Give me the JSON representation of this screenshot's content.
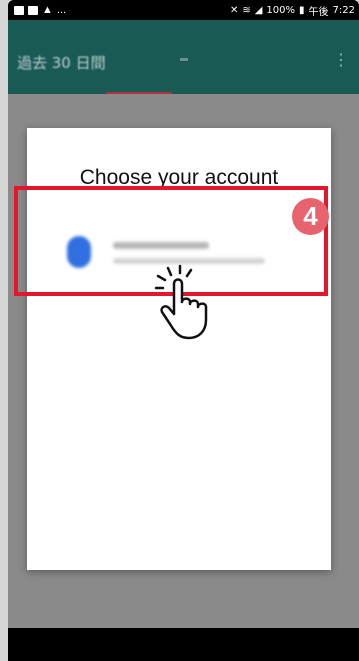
{
  "status_bar": {
    "battery": "100%",
    "period": "午後",
    "time": "7:22"
  },
  "app_bar": {
    "title": "過去 30 日間",
    "more": "⋮"
  },
  "dialog": {
    "title": "Choose your account"
  },
  "callout": {
    "step": "4"
  },
  "colors": {
    "app_bar": "#0e5d57",
    "tab_indicator": "#c62a3a",
    "highlight": "#e3162b",
    "badge": "#e8636e",
    "avatar": "#2f6fe0"
  }
}
